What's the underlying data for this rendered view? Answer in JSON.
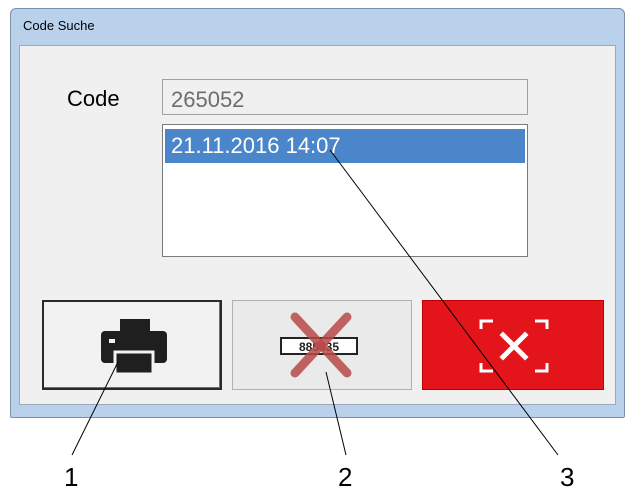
{
  "window": {
    "title": "Code Suche"
  },
  "code": {
    "label": "Code",
    "value": "265052"
  },
  "list": {
    "items": [
      "21.11.2016 14:07"
    ]
  },
  "buttons": {
    "print_icon": "printer-icon",
    "delete_icon": "delete-code-icon",
    "delete_code_text": "885435",
    "close_icon": "close-x-icon"
  },
  "callouts": [
    "1",
    "2",
    "3"
  ],
  "colors": {
    "selection": "#4a86c9",
    "close_button": "#e3141a"
  }
}
